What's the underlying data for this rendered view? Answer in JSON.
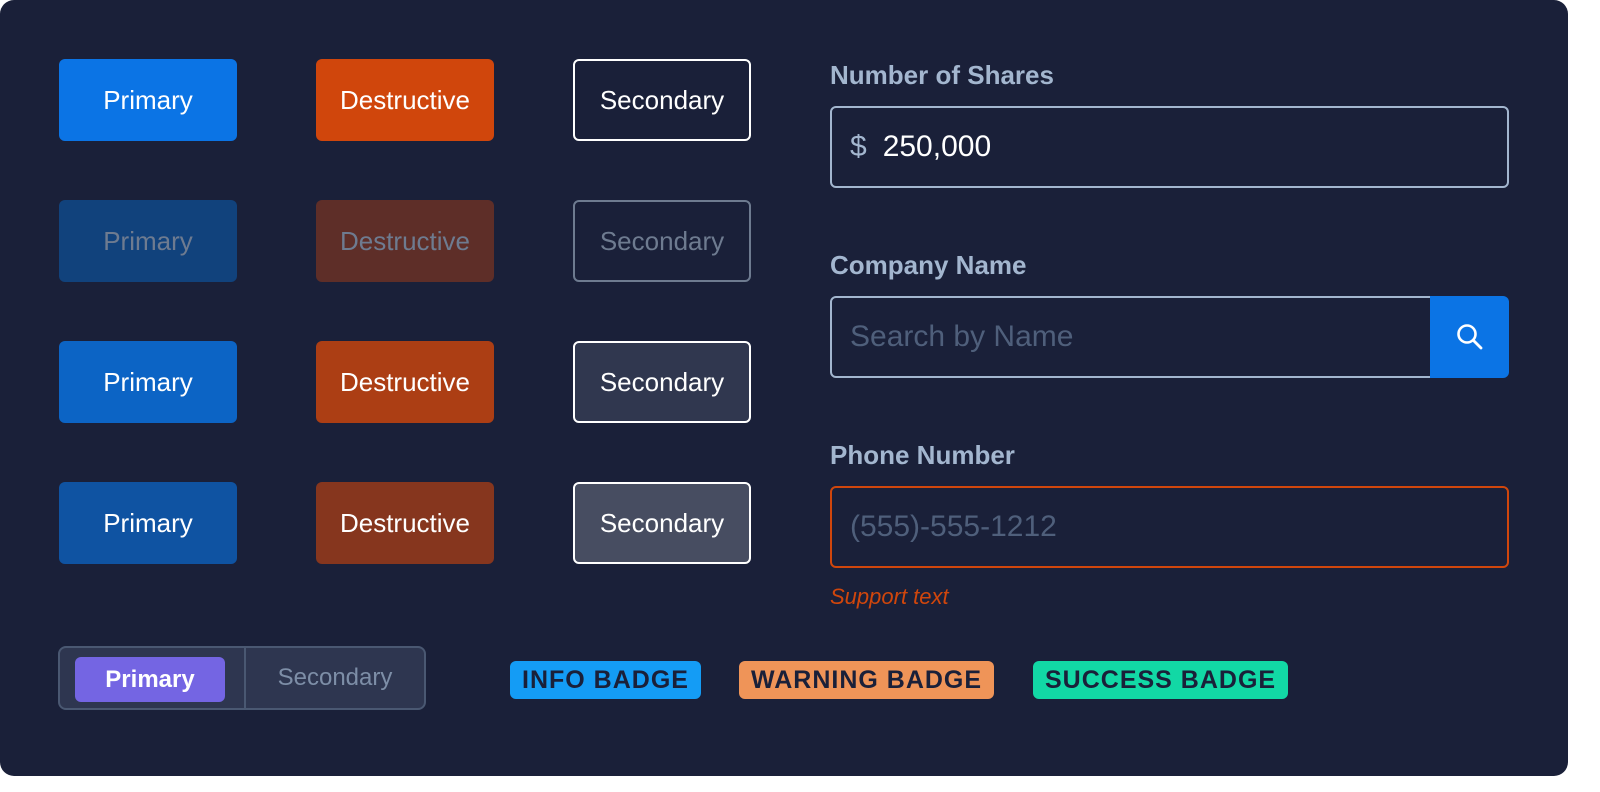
{
  "buttons": {
    "primary_label": "Primary",
    "destructive_label": "Destructive",
    "secondary_label": "Secondary",
    "states": [
      "default",
      "disabled",
      "hover",
      "pressed"
    ]
  },
  "fields": {
    "shares": {
      "label": "Number of Shares",
      "prefix": "$",
      "value": "250,000"
    },
    "company": {
      "label": "Company Name",
      "placeholder": "Search by Name",
      "button_icon": "search-icon"
    },
    "phone": {
      "label": "Phone Number",
      "placeholder": "(555)-555-1212",
      "support_text": "Support text"
    }
  },
  "segmented": {
    "options": [
      "Primary",
      "Secondary"
    ],
    "selected": "Primary"
  },
  "badges": {
    "info": "INFO BADGE",
    "warning": "WARNING BADGE",
    "success": "SUCCESS BADGE"
  },
  "colors": {
    "background": "#1a2039",
    "primary": "#0b74e5",
    "destructive": "#d0460c",
    "accent_purple": "#7465e3",
    "label": "#a3b6cf",
    "info": "#149cf5",
    "warning": "#ef9458",
    "success": "#12d8a5"
  }
}
